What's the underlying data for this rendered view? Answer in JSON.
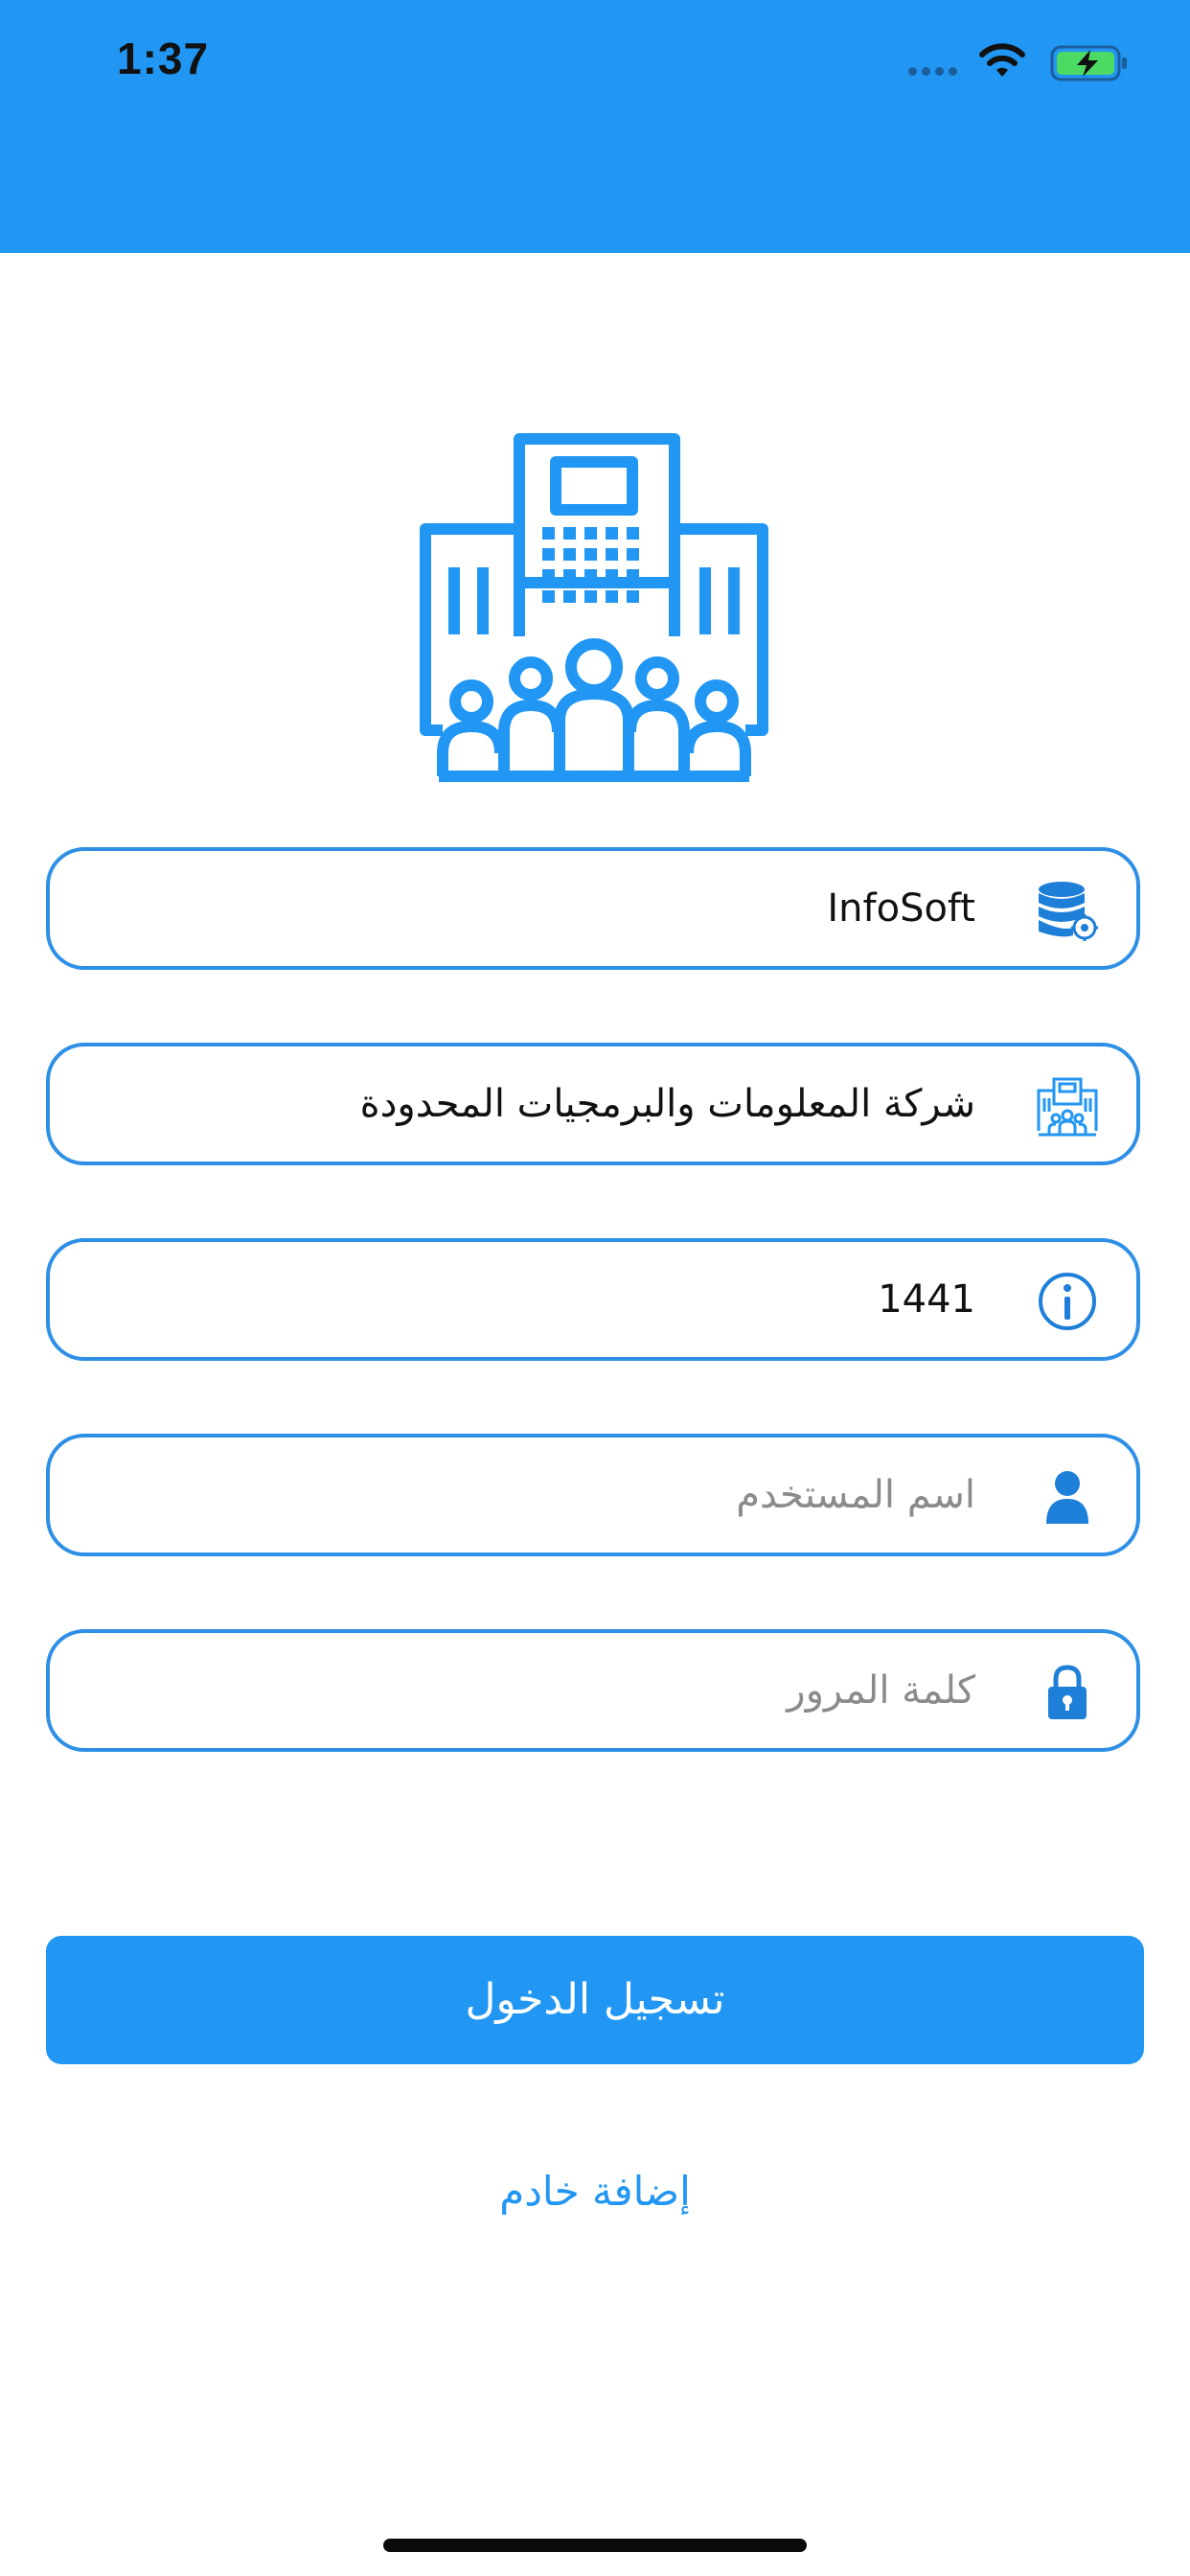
{
  "status_bar": {
    "time": "1:37",
    "icons": [
      "signal-dots-icon",
      "wifi-icon",
      "battery-charging-icon"
    ]
  },
  "colors": {
    "primary": "#2196f3",
    "field_border": "#2d8fe6",
    "placeholder": "#8b8b8b",
    "text": "#111111"
  },
  "logo": {
    "icon": "company-building-people-icon"
  },
  "form": {
    "database": {
      "value": "InfoSoft",
      "icon": "database-gear-icon"
    },
    "company": {
      "value": "شركة المعلومات والبرمجيات المحدودة",
      "icon": "building-icon"
    },
    "year": {
      "value": "1441",
      "icon": "info-icon"
    },
    "username": {
      "placeholder": "اسم المستخدم",
      "icon": "user-icon"
    },
    "password": {
      "placeholder": "كلمة المرور",
      "icon": "lock-icon"
    }
  },
  "login_button": {
    "label": "تسجيل الدخول"
  },
  "add_server": {
    "label": "إضافة خادم"
  }
}
